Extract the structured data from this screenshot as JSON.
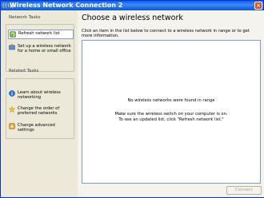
{
  "window": {
    "title": "Wireless Network Connection 2"
  },
  "sidebar": {
    "network_tasks": {
      "title": "Network Tasks",
      "items": [
        {
          "label": "Refresh network list",
          "icon": "refresh-icon"
        },
        {
          "label": "Set up a wireless network\nfor a home or small office",
          "icon": "setup-network-icon"
        }
      ]
    },
    "related_tasks": {
      "title": "Related Tasks",
      "items": [
        {
          "label": "Learn about wireless\nnetworking",
          "icon": "info-icon"
        },
        {
          "label": "Change the order of\npreferred networks",
          "icon": "star-icon"
        },
        {
          "label": "Change advanced\nsettings",
          "icon": "settings-icon"
        }
      ]
    }
  },
  "main": {
    "heading": "Choose a wireless network",
    "instructions": "Click an item in the list below to connect to a wireless network in range or to get more information.",
    "empty_message": "No wireless networks were found in range",
    "hint": "Make sure the wireless switch on your computer is on.\nTo see an updated list, click \"Refresh network list.\"",
    "connect_label": "Connect"
  }
}
